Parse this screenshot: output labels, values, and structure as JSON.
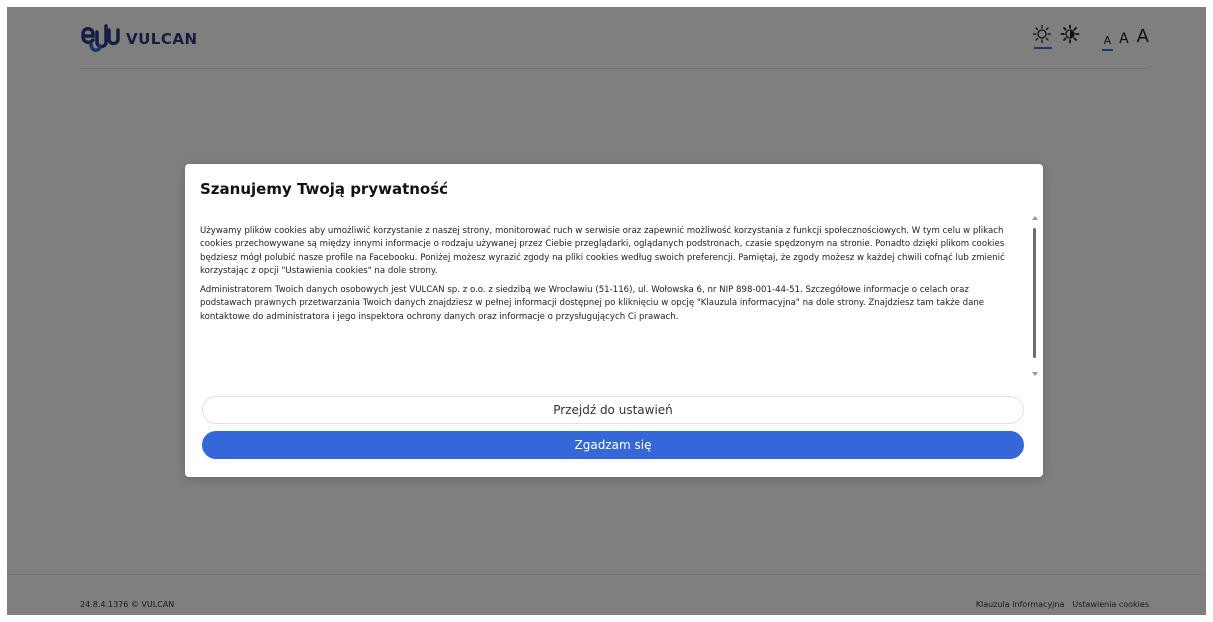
{
  "header": {
    "logo_text": "VULCAN",
    "theme_light_icon": "sun-icon",
    "theme_contrast_icon": "contrast-sun-icon",
    "font_sizes": [
      "A",
      "A",
      "A"
    ]
  },
  "footer": {
    "version": "24.8.4.1376 © VULCAN",
    "link_info": "Klauzula informacyjna",
    "link_cookies": "Ustawienia cookies"
  },
  "modal": {
    "title": "Szanujemy Twoją prywatność",
    "paragraph1": "Używamy plików cookies aby umożliwić korzystanie z naszej strony, monitorować ruch w serwisie oraz zapewnić możliwość korzystania z funkcji społecznościowych. W tym celu w plikach cookies przechowywane są między innymi informacje o rodzaju używanej przez Ciebie przeglądarki, oglądanych podstronach, czasie spędzonym na stronie. Ponadto dzięki plikom cookies będziesz mógł polubić nasze profile na Facebooku. Poniżej możesz wyrazić zgody na pliki cookies według swoich preferencji. Pamiętaj, że zgody możesz w każdej chwili cofnąć lub zmienić korzystając z opcji \"Ustawienia cookies\" na dole strony.",
    "paragraph2": "Administratorem Twoich danych osobowych jest VULCAN sp. z o.o. z siedzibą we Wrocławiu (51-116), ul. Wołowska 6, nr NIP 898-001-44-51. Szczegółowe informacje o celach oraz podstawach prawnych przetwarzania Twoich danych znajdziesz w pełnej informacji dostępnej po kliknięciu w opcję \"Klauzula informacyjna\" na dole strony. Znajdziesz tam także dane kontaktowe do administratora i jego inspektora ochrony danych oraz informacje o przysługujących Ci prawach.",
    "settings_button": "Przejdź do ustawień",
    "accept_button": "Zgadzam się"
  },
  "colors": {
    "accent": "#3567d8",
    "brand": "#2b3a82",
    "overlay": "rgba(0,0,0,0.5)"
  }
}
